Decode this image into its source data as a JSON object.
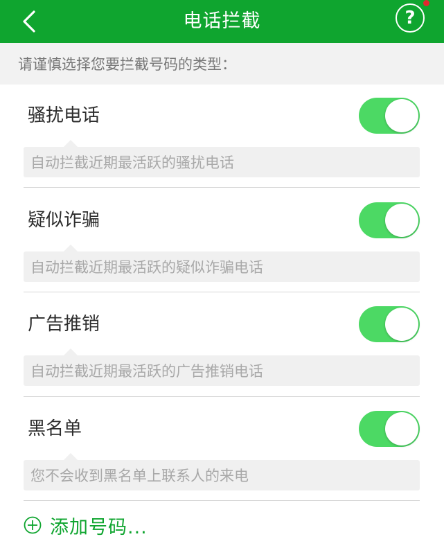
{
  "header": {
    "title": "电话拦截",
    "back_icon": "chevron-left-icon",
    "help_label": "?",
    "help_icon": "question-circle-icon",
    "bar_color": "#0fa52f",
    "dot_color": "#e3262e"
  },
  "hint": "请谨慎选择您要拦截号码的类型：",
  "categories": [
    {
      "label": "骚扰电话",
      "enabled": true,
      "description": "自动拦截近期最活跃的骚扰电话"
    },
    {
      "label": "疑似诈骗",
      "enabled": true,
      "description": "自动拦截近期最活跃的疑似诈骗电话"
    },
    {
      "label": "广告推销",
      "enabled": true,
      "description": "自动拦截近期最活跃的广告推销电话"
    },
    {
      "label": "黑名单",
      "enabled": true,
      "description": "您不会收到黑名单上联系人的来电"
    }
  ],
  "toggle_on_color": "#4cd964",
  "add_number": {
    "label": "添加号码...",
    "icon": "plus-circle-icon"
  }
}
